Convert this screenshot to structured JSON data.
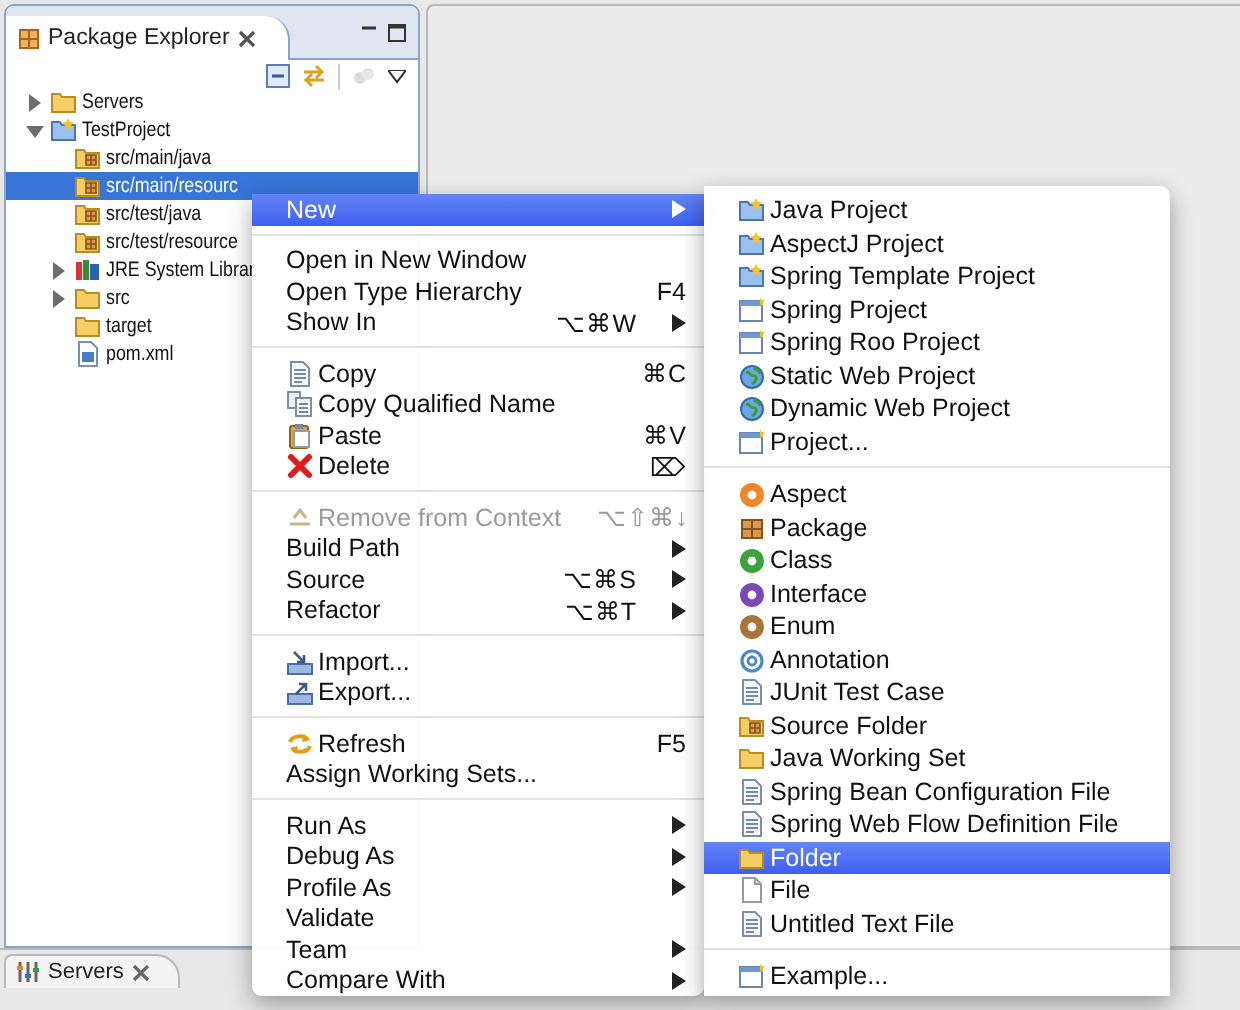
{
  "explorer": {
    "title": "Package Explorer",
    "tree": [
      {
        "label": "Servers",
        "kind": "folder",
        "expanded": false,
        "selected": false
      },
      {
        "label": "TestProject",
        "kind": "project",
        "expanded": true,
        "selected": false,
        "children": [
          {
            "label": "src/main/java",
            "kind": "package_folder",
            "selected": false
          },
          {
            "label": "src/main/resourc",
            "kind": "package_folder",
            "selected": true
          },
          {
            "label": "src/test/java",
            "kind": "package_folder",
            "selected": false
          },
          {
            "label": "src/test/resource",
            "kind": "package_folder",
            "selected": false
          },
          {
            "label": "JRE System Librar",
            "kind": "library",
            "expanded": false,
            "selected": false
          },
          {
            "label": "src",
            "kind": "folder",
            "expanded": false,
            "selected": false
          },
          {
            "label": "target",
            "kind": "folder",
            "selected": false
          },
          {
            "label": "pom.xml",
            "kind": "xml_file",
            "selected": false
          }
        ]
      }
    ]
  },
  "bottom_panel": {
    "tab": "Servers"
  },
  "context_menu": {
    "groups": [
      [
        {
          "label": "New",
          "kind": "plain",
          "submenu": true,
          "disabled": false,
          "selected": true
        }
      ],
      [
        {
          "label": "Open in New Window",
          "kind": "plain",
          "submenu": false,
          "disabled": false,
          "selected": false
        },
        {
          "label": "Open Type Hierarchy",
          "kind": "plain",
          "shortcut": "F4",
          "submenu": false,
          "disabled": false,
          "selected": false
        },
        {
          "label": "Show In",
          "kind": "plain",
          "shortcut": "⌥⌘W",
          "submenu": true,
          "disabled": false,
          "selected": false
        }
      ],
      [
        {
          "label": "Copy",
          "kind": "copy",
          "shortcut": "⌘C",
          "submenu": false,
          "disabled": false,
          "selected": false
        },
        {
          "label": "Copy Qualified Name",
          "kind": "copy_qualified",
          "submenu": false,
          "disabled": false,
          "selected": false
        },
        {
          "label": "Paste",
          "kind": "paste",
          "shortcut": "⌘V",
          "submenu": false,
          "disabled": false,
          "selected": false
        },
        {
          "label": "Delete",
          "kind": "delete",
          "shortcut": "⌦",
          "submenu": false,
          "disabled": false,
          "selected": false
        }
      ],
      [
        {
          "label": "Remove from Context",
          "kind": "remove",
          "shortcut": "⌥⇧⌘↓",
          "submenu": false,
          "disabled": true,
          "selected": false
        },
        {
          "label": "Build Path",
          "kind": "plain",
          "submenu": true,
          "disabled": false,
          "selected": false
        },
        {
          "label": "Source",
          "kind": "plain",
          "shortcut": "⌥⌘S",
          "submenu": true,
          "disabled": false,
          "selected": false
        },
        {
          "label": "Refactor",
          "kind": "plain",
          "shortcut": "⌥⌘T",
          "submenu": true,
          "disabled": false,
          "selected": false
        }
      ],
      [
        {
          "label": "Import...",
          "kind": "import",
          "submenu": false,
          "disabled": false,
          "selected": false
        },
        {
          "label": "Export...",
          "kind": "export",
          "submenu": false,
          "disabled": false,
          "selected": false
        }
      ],
      [
        {
          "label": "Refresh",
          "kind": "refresh",
          "shortcut": "F5",
          "submenu": false,
          "disabled": false,
          "selected": false
        },
        {
          "label": "Assign Working Sets...",
          "kind": "plain",
          "submenu": false,
          "disabled": false,
          "selected": false
        }
      ],
      [
        {
          "label": "Run As",
          "kind": "plain",
          "submenu": true,
          "disabled": false,
          "selected": false
        },
        {
          "label": "Debug As",
          "kind": "plain",
          "submenu": true,
          "disabled": false,
          "selected": false
        },
        {
          "label": "Profile As",
          "kind": "plain",
          "submenu": true,
          "disabled": false,
          "selected": false
        },
        {
          "label": "Validate",
          "kind": "plain",
          "submenu": false,
          "disabled": false,
          "selected": false
        },
        {
          "label": "Team",
          "kind": "plain",
          "submenu": true,
          "disabled": false,
          "selected": false
        },
        {
          "label": "Compare With",
          "kind": "plain",
          "submenu": true,
          "disabled": false,
          "selected": false
        }
      ]
    ]
  },
  "submenu": {
    "groups": [
      [
        {
          "label": "Java Project",
          "kind": "project",
          "selected": false
        },
        {
          "label": "AspectJ Project",
          "kind": "project",
          "selected": false
        },
        {
          "label": "Spring Template Project",
          "kind": "project",
          "selected": false
        },
        {
          "label": "Spring Project",
          "kind": "window",
          "selected": false
        },
        {
          "label": "Spring Roo Project",
          "kind": "window",
          "selected": false
        },
        {
          "label": "Static Web Project",
          "kind": "globe",
          "selected": false
        },
        {
          "label": "Dynamic Web Project",
          "kind": "globe",
          "selected": false
        },
        {
          "label": "Project...",
          "kind": "window",
          "selected": false
        }
      ],
      [
        {
          "label": "Aspect",
          "kind": "circle",
          "color": "#f0852a",
          "selected": false
        },
        {
          "label": "Package",
          "kind": "package",
          "selected": false
        },
        {
          "label": "Class",
          "kind": "circle",
          "color": "#3ca23c",
          "selected": false
        },
        {
          "label": "Interface",
          "kind": "circle",
          "color": "#7a48b8",
          "selected": false
        },
        {
          "label": "Enum",
          "kind": "circle",
          "color": "#a8743a",
          "selected": false
        },
        {
          "label": "Annotation",
          "kind": "ring",
          "selected": false
        },
        {
          "label": "JUnit Test Case",
          "kind": "document",
          "selected": false
        },
        {
          "label": "Source Folder",
          "kind": "package_folder",
          "selected": false
        },
        {
          "label": "Java Working Set",
          "kind": "folder",
          "selected": false
        },
        {
          "label": "Spring Bean Configuration File",
          "kind": "document",
          "selected": false
        },
        {
          "label": "Spring Web Flow Definition File",
          "kind": "document",
          "selected": false
        },
        {
          "label": "Folder",
          "kind": "folder",
          "selected": true
        },
        {
          "label": "File",
          "kind": "file",
          "selected": false
        },
        {
          "label": "Untitled Text File",
          "kind": "document",
          "selected": false
        }
      ],
      [
        {
          "label": "Example...",
          "kind": "window",
          "selected": false
        }
      ]
    ]
  }
}
